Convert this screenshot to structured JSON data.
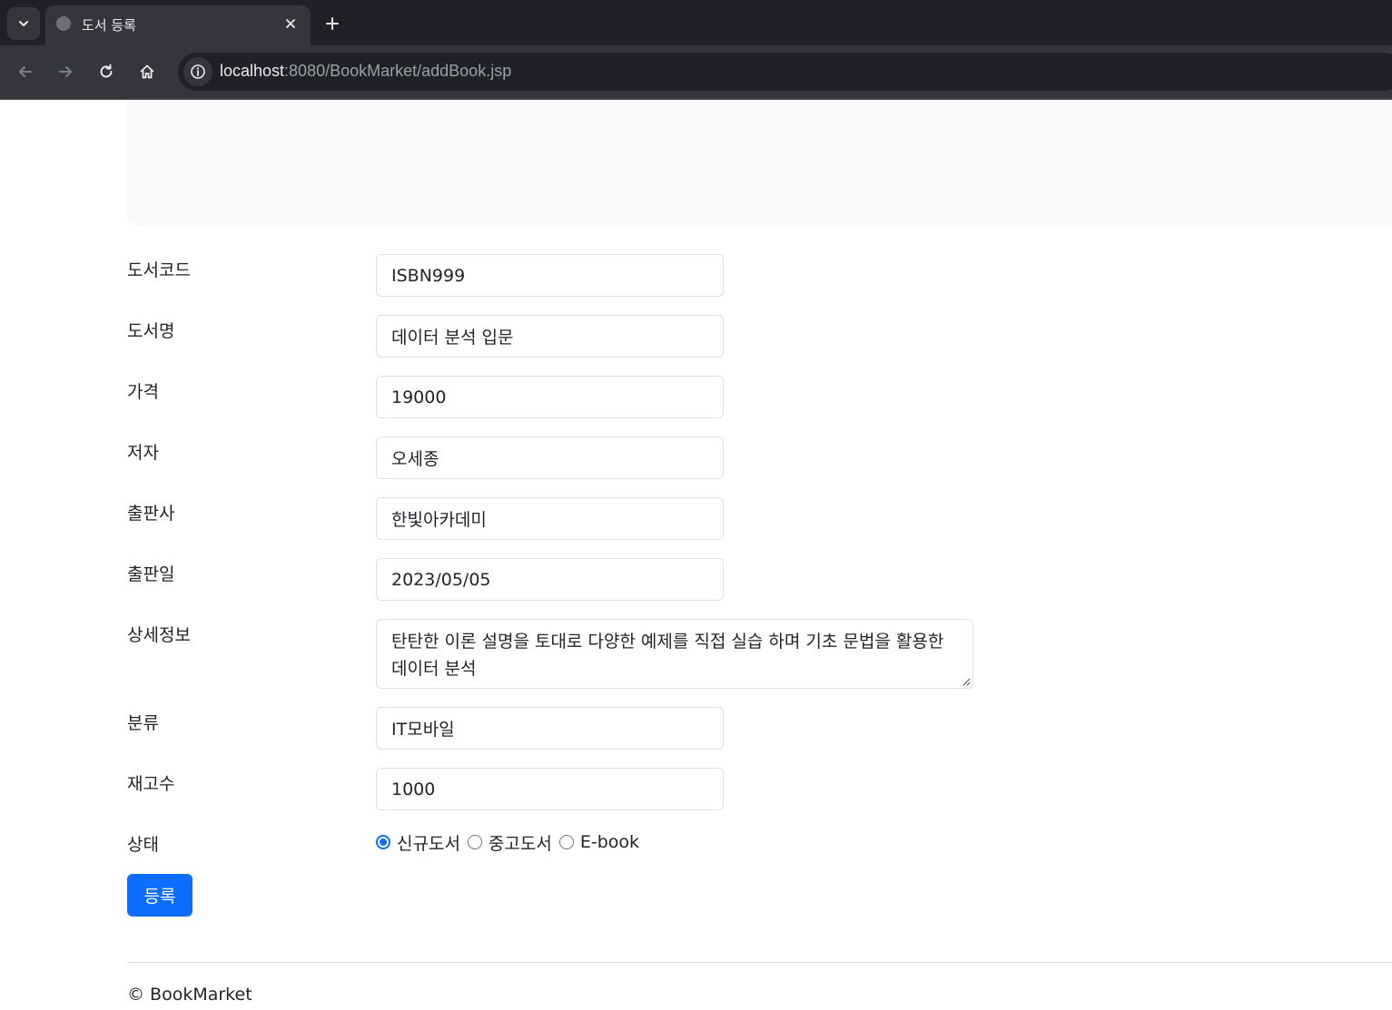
{
  "browser": {
    "tab_title": "도서 등록",
    "url_host": "localhost",
    "url_path": ":8080/BookMarket/addBook.jsp"
  },
  "form": {
    "fields": [
      {
        "label": "도서코드",
        "value": "ISBN999"
      },
      {
        "label": "도서명",
        "value": "데이터 분석 입문"
      },
      {
        "label": "가격",
        "value": "19000"
      },
      {
        "label": "저자",
        "value": "오세종"
      },
      {
        "label": "출판사",
        "value": "한빛아카데미"
      },
      {
        "label": "출판일",
        "value": "2023/05/05"
      }
    ],
    "description": {
      "label": "상세정보",
      "value": "탄탄한 이론 설명을 토대로 다양한 예제를 직접 실습 하며 기초 문법을 활용한 데이터 분석"
    },
    "fields2": [
      {
        "label": "분류",
        "value": "IT모바일"
      },
      {
        "label": "재고수",
        "value": "1000"
      }
    ],
    "condition": {
      "label": "상태",
      "options": [
        "신규도서",
        "중고도서",
        "E-book"
      ],
      "selected": "신규도서"
    },
    "submit_label": "등록"
  },
  "footer": {
    "text": "© BookMarket"
  },
  "icons": {
    "tab_menu": "chevron-down-icon",
    "close": "close-icon",
    "new_tab": "plus-icon",
    "back": "arrow-left-icon",
    "forward": "arrow-right-icon",
    "reload": "reload-icon",
    "home": "home-icon",
    "site_info": "info-icon"
  },
  "colors": {
    "primary": "#0d6efd",
    "jumbotron": "#f8f9fa",
    "chrome_dark": "#202124",
    "chrome_mid": "#35363a"
  }
}
